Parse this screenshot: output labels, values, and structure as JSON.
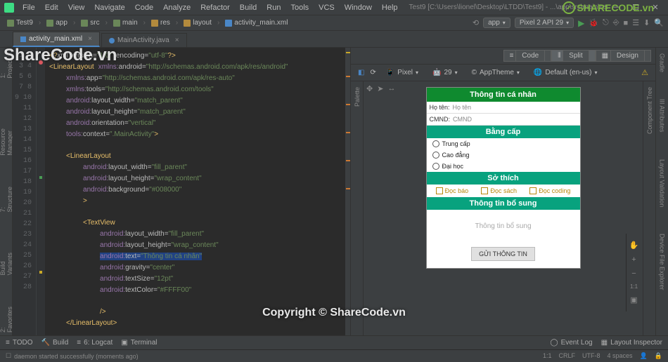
{
  "menu": {
    "file": "File",
    "edit": "Edit",
    "view": "View",
    "navigate": "Navigate",
    "code": "Code",
    "analyze": "Analyze",
    "refactor": "Refactor",
    "build": "Build",
    "run": "Run",
    "tools": "Tools",
    "vcs": "VCS",
    "window": "Window",
    "help": "Help"
  },
  "title_rest": "Test9 [C:\\Users\\lionel\\Desktop\\LTDD\\Test9] - ...\\app\\src\\main\\res\\layout\\activity_main.xml [app] - Android Studio",
  "breadcrumbs": [
    "Test9",
    "app",
    "src",
    "main",
    "res",
    "layout",
    "activity_main.xml"
  ],
  "run_config": {
    "module": "app",
    "device": "Pixel 2 API 29"
  },
  "tabs": [
    {
      "label": "activity_main.xml",
      "active": true
    },
    {
      "label": "MainActivity.java",
      "active": false
    }
  ],
  "left_tools": [
    "1: Project",
    "Resource Manager",
    "7: Structure",
    "Build Variants",
    "2: Favorites"
  ],
  "code_lines": [
    1,
    2,
    3,
    4,
    5,
    6,
    7,
    8,
    9,
    10,
    11,
    12,
    13,
    14,
    15,
    16,
    17,
    18,
    19,
    20,
    21,
    22,
    23,
    24,
    25,
    26,
    27,
    28
  ],
  "view_modes": {
    "code": "Code",
    "split": "Split",
    "design": "Design"
  },
  "preview_toolbar": {
    "pixel": "Pixel",
    "api": "29",
    "theme": "AppTheme",
    "locale": "Default (en-us)"
  },
  "palette": "Palette",
  "component_tree": "Component Tree",
  "device": {
    "header1": "Thông tin cá nhân",
    "field1_label": "Họ tên:",
    "field1_hint": "Họ tên",
    "field2_label": "CMND:",
    "field2_hint": "CMND",
    "header2": "Bằng cấp",
    "radio1": "Trung cấp",
    "radio2": "Cao đẳng",
    "radio3": "Đại học",
    "header3": "Sở thích",
    "check1": "Đọc báo",
    "check2": "Đọc sách",
    "check3": "Đọc coding",
    "header4": "Thông tin bổ sung",
    "hint": "Thông tin bổ sung",
    "button": "GỬI THÔNG TIN"
  },
  "right_tools": [
    "Gradle",
    "III Attributes",
    "Layout Validation",
    "Device File Explorer"
  ],
  "bottom_tabs": {
    "todo": "TODO",
    "build": "Build",
    "logcat": "6: Logcat",
    "terminal": "Terminal",
    "eventlog": "Event Log",
    "inspector": "Layout Inspector"
  },
  "status": {
    "msg": "daemon started successfully (moments ago)",
    "pos": "1:1",
    "line_sep": "CRLF",
    "encoding": "UTF-8",
    "indent": "4 spaces"
  },
  "watermark1": "ShareCode.vn",
  "watermark2": "Copyright © ShareCode.vn",
  "logo_text": "SHARECODE.vn"
}
